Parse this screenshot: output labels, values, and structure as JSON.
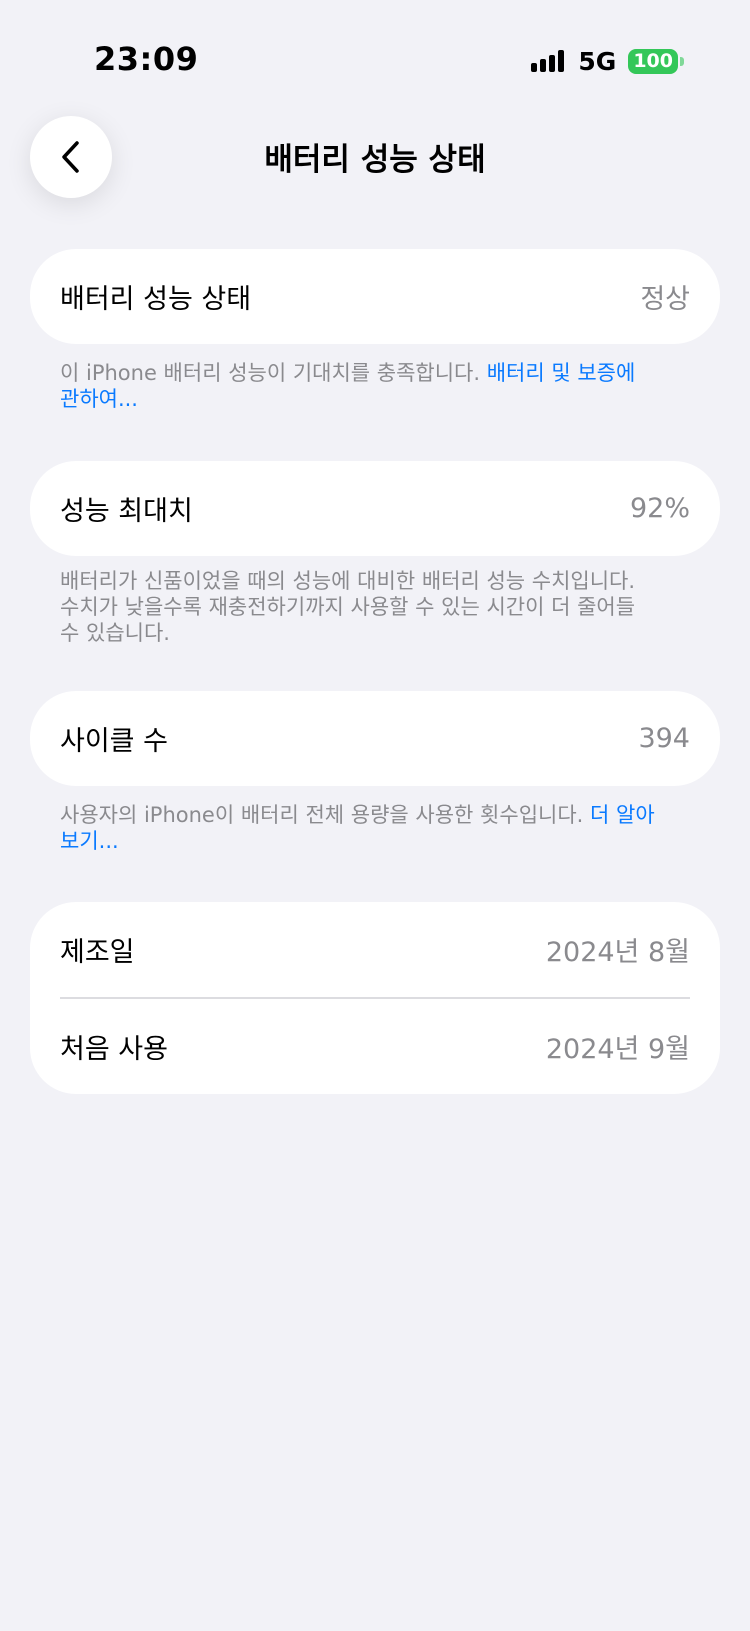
{
  "status": {
    "time": "23:09",
    "network": "5G",
    "battery": "100"
  },
  "nav": {
    "title": "배터리 성능 상태"
  },
  "battery_health": {
    "label": "배터리 성능 상태",
    "value": "정상",
    "note_text": "이 iPhone 배터리 성능이 기대치를 충족합니다. ",
    "note_link": "배터리 및 보증에 관하여..."
  },
  "max_capacity": {
    "label": "성능 최대치",
    "value": "92%",
    "note_text": "배터리가 신품이었을 때의 성능에 대비한 배터리 성능 수치입니다. 수치가 낮을수록 재충전하기까지 사용할 수 있는 시간이 더 줄어들 수 있습니다."
  },
  "cycle_count": {
    "label": "사이클 수",
    "value": "394",
    "note_text": "사용자의 iPhone이 배터리 전체 용량을 사용한 횟수입니다. ",
    "note_link": "더 알아보기..."
  },
  "dates": {
    "manufacture_label": "제조일",
    "manufacture_value": "2024년 8월",
    "first_use_label": "처음 사용",
    "first_use_value": "2024년 9월"
  }
}
